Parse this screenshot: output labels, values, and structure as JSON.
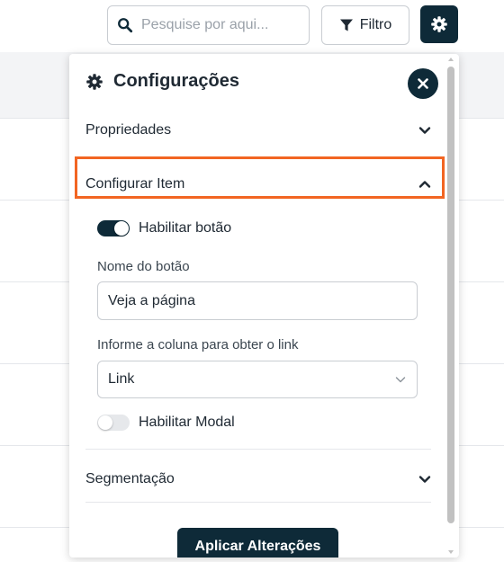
{
  "toolbar": {
    "search_placeholder": "Pesquise por aqui...",
    "search_icon": "search-icon",
    "filter_label": "Filtro",
    "filter_icon": "funnel-icon",
    "settings_icon": "gear-icon"
  },
  "panel": {
    "title": "Configurações",
    "title_icon": "gear-icon",
    "close_icon": "close-icon",
    "sections": {
      "properties": {
        "label": "Propriedades",
        "state": "collapsed"
      },
      "configure_item": {
        "label": "Configurar Item",
        "state": "expanded"
      },
      "segmentation": {
        "label": "Segmentação",
        "state": "collapsed"
      }
    },
    "enable_button": {
      "label": "Habilitar botão",
      "checked": true
    },
    "button_name": {
      "label": "Nome do botão",
      "value": "Veja a página"
    },
    "link_column": {
      "label": "Informe a coluna para obter o link",
      "selected": "Link"
    },
    "enable_modal": {
      "label": "Habilitar Modal",
      "checked": false
    },
    "apply_label": "Aplicar Alterações"
  },
  "colors": {
    "accent_dark": "#0e2a38",
    "highlight": "#f26522",
    "border": "#c9cdd2"
  }
}
